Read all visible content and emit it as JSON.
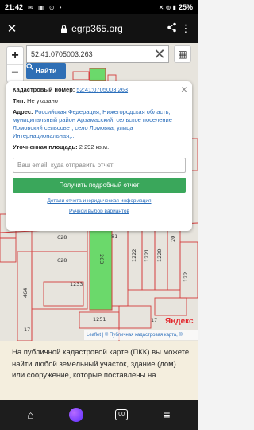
{
  "status": {
    "time": "21:42",
    "left_icons": "✉ ▣ ⊙ •",
    "right_icons": "✕ ⊚ ▮",
    "battery": "25%"
  },
  "browser": {
    "url": "egrp365.org",
    "close_icon": "close-icon",
    "share_icon": "share-icon",
    "more_icon": "more-icon"
  },
  "map": {
    "search_value": "52:41:0705003:263",
    "clear_symbol": "✕",
    "find_label": "Найти",
    "zoom_in": "+",
    "zoom_out": "−",
    "labels": [
      "628",
      "628",
      "464",
      "263",
      "1222",
      "1221",
      "1220",
      "1251",
      "1233",
      "122",
      "17",
      "17",
      "81",
      "20"
    ],
    "yandex": "Яндекс",
    "attribution": "Leaflet | © Публичная кадастровая карта, ©"
  },
  "popup": {
    "kad_label": "Кадастровый номер:",
    "kad_value": "52:41:0705003:263",
    "type_label": "Тип:",
    "type_value": "Не указано",
    "address_label": "Адрес:",
    "address_value": "Российская Федерация, Нижегородская область, муниципальный район Арзамасский, сельское поселение Ломовский сельсовет, село Ломовка, улица Интернациональная,...",
    "area_label": "Уточненная площадь:",
    "area_value": "2 292 кв.м.",
    "email_placeholder": "Ваш email, куда отправить отчет",
    "report_button": "Получить подробный отчет",
    "details_link": "Детали отчета и юридическая информация",
    "manual_link": "Ручной выбор вариантов"
  },
  "info_text": "На публичной кадастровой карте (ПКК) вы можете найти любой земельный участок, здание (дом) или сооружение, которые поставлены на",
  "navbar": {
    "home": "⌂",
    "tabs_count": "00",
    "menu": "≡"
  },
  "colors": {
    "parcel_outline": "#d43c3c",
    "selected_parcel": "#6bd96b",
    "find_button": "#2f6fb5",
    "report_button": "#3aa75b",
    "link": "#2a6ebb"
  }
}
